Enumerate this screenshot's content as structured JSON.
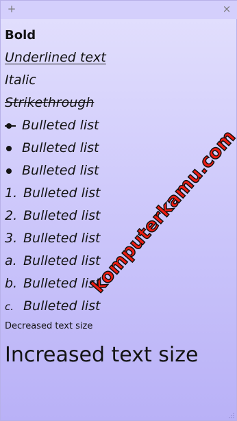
{
  "titlebar": {
    "add_icon": "+",
    "close_icon": "×"
  },
  "note": {
    "lines": {
      "bold": "Bold",
      "underline": "Underlined text",
      "italic": "Italic",
      "strike": "Strikethrough",
      "bullet1": "Bulleted list",
      "bullet2": "Bulleted list",
      "bullet3": "Bulleted list",
      "num1_marker": "1.",
      "num1": "Bulleted list",
      "num2_marker": "2.",
      "num2": "Bulleted list",
      "num3_marker": "3.",
      "num3": "Bulleted list",
      "alpha1_marker": "a.",
      "alpha1": "Bulleted list",
      "alpha2_marker": "b.",
      "alpha2": "Bulleted list",
      "alpha3_marker": "c.",
      "alpha3": "Bulleted list",
      "small": "Decreased text size",
      "big": "Increased text size"
    }
  },
  "watermark": {
    "text": "komputerkamu.com"
  },
  "colors": {
    "background_top": "#e3e0fd",
    "background_bottom": "#b9b1f7",
    "titlebar": "#d4cffc",
    "watermark": "#ee1c12"
  }
}
